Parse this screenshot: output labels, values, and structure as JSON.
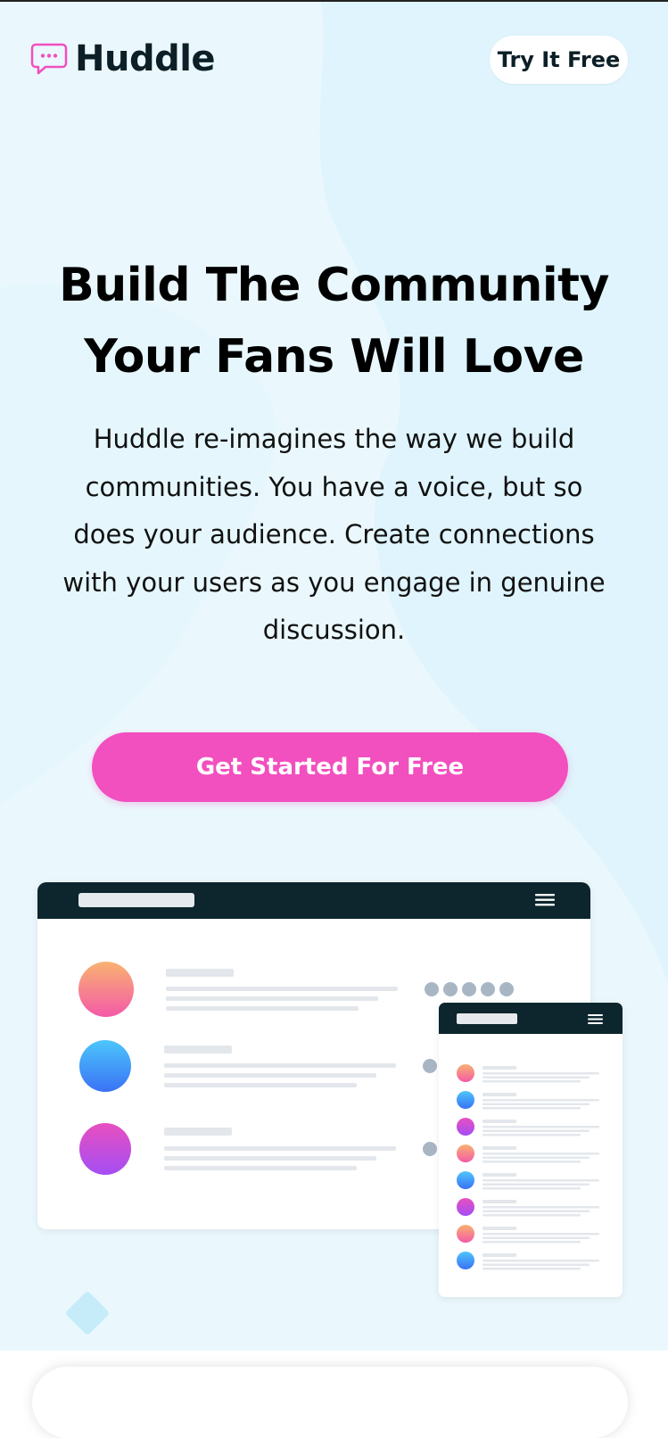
{
  "brand": {
    "name": "Huddle"
  },
  "header": {
    "try_label": "Try It Free"
  },
  "hero": {
    "headline": "Build The Community Your Fans Will Love",
    "description": "Huddle re-imagines the way we build communities. You have a voice, but so does your audience. Create connections with your users as you engage in genuine discussion.",
    "cta_label": "Get Started For Free"
  },
  "colors": {
    "accent_pink": "#f24fbf",
    "dark_navy": "#0c1f26",
    "hero_bg": "#eaf8fd"
  },
  "icons": {
    "logo": "chat-bubble-icon",
    "menu": "hamburger-menu-icon"
  }
}
